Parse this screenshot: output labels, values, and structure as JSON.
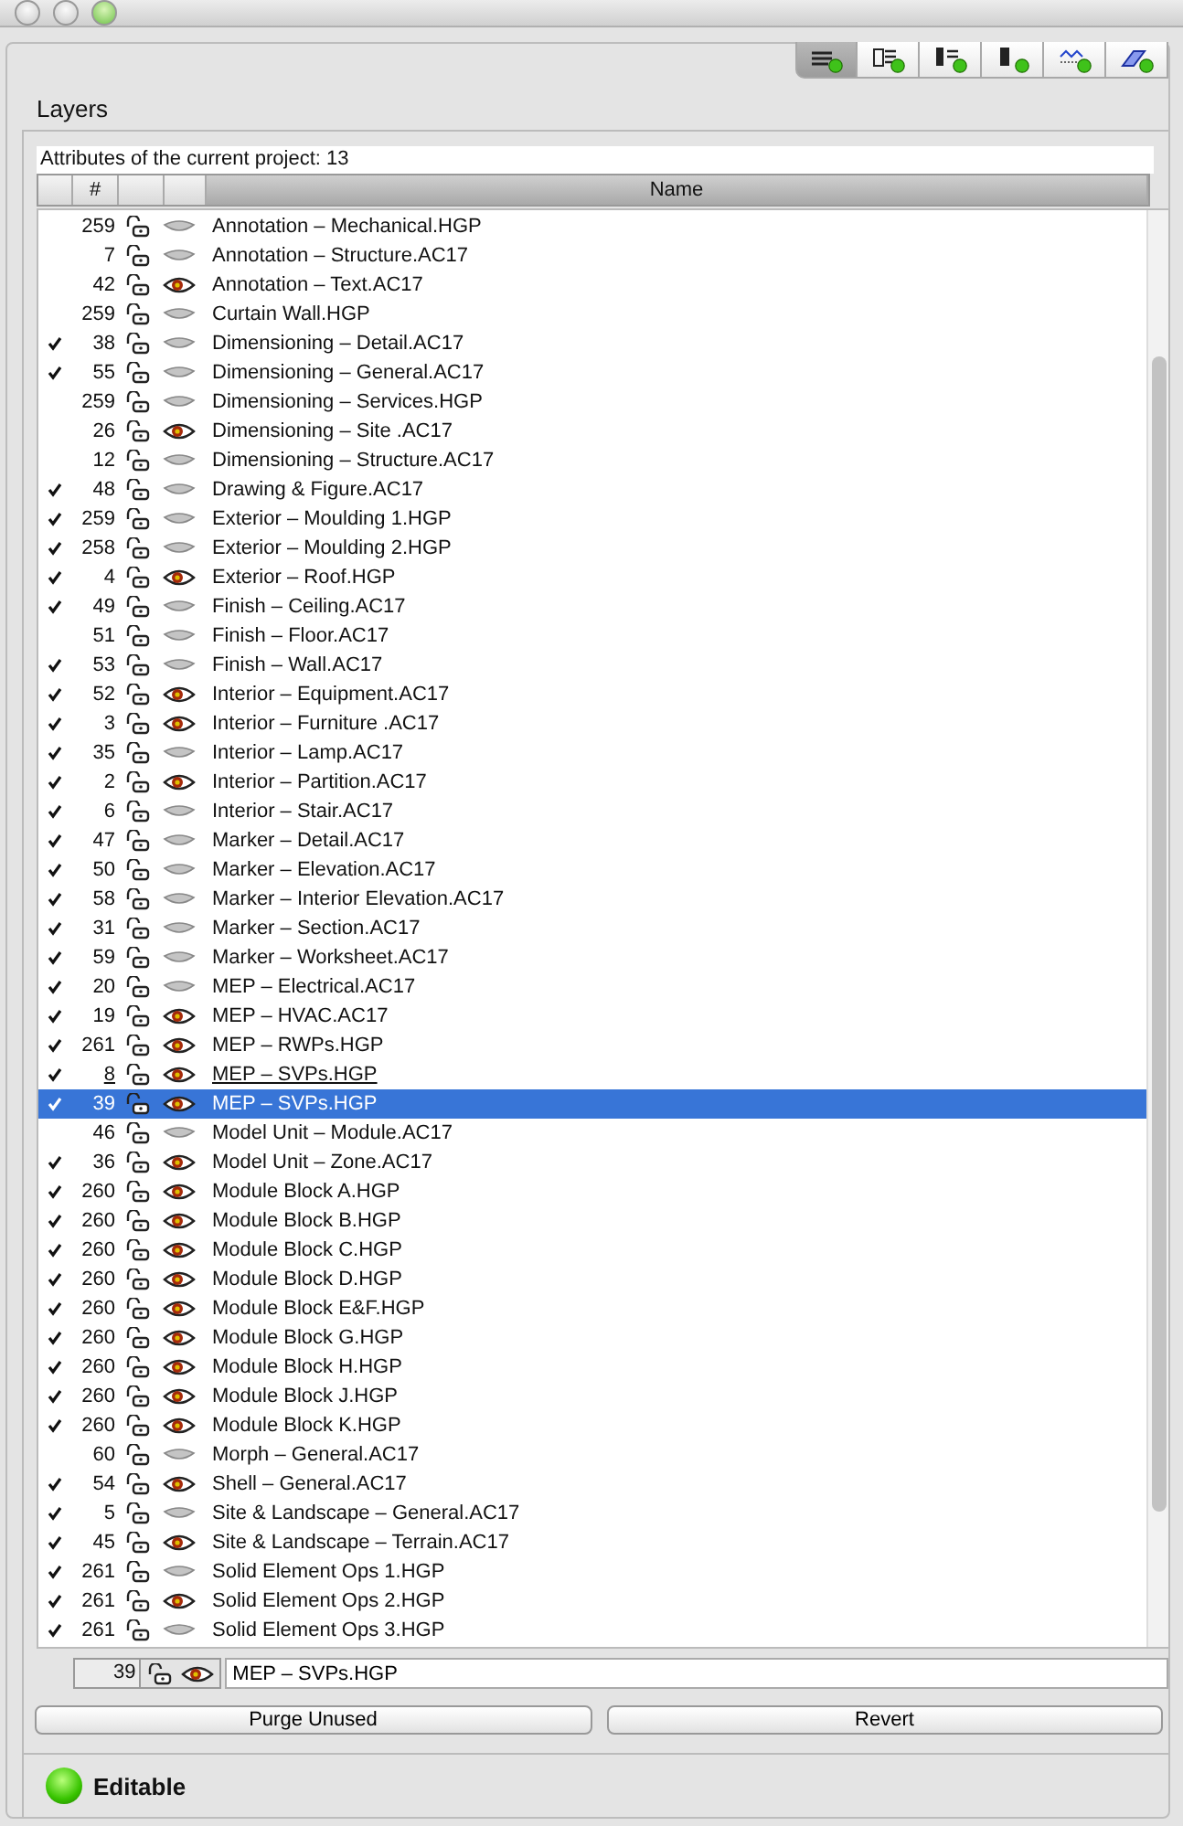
{
  "toolbar": [
    {
      "selected": true
    },
    {
      "selected": false
    },
    {
      "selected": false
    },
    {
      "selected": false
    },
    {
      "selected": false
    },
    {
      "selected": false
    }
  ],
  "panel_title": "Layers",
  "attributes_caption": "Attributes of the current project: 13",
  "table": {
    "columns": [
      "#",
      "Name"
    ],
    "rows": [
      {
        "checked": false,
        "number": "259",
        "visible": false,
        "name": "Annotation – Mechanical.HGP",
        "underlined": false,
        "selected": false
      },
      {
        "checked": false,
        "number": "7",
        "visible": false,
        "name": "Annotation – Structure.AC17",
        "underlined": false,
        "selected": false
      },
      {
        "checked": false,
        "number": "42",
        "visible": true,
        "name": "Annotation – Text.AC17",
        "underlined": false,
        "selected": false
      },
      {
        "checked": false,
        "number": "259",
        "visible": false,
        "name": "Curtain Wall.HGP",
        "underlined": false,
        "selected": false
      },
      {
        "checked": true,
        "number": "38",
        "visible": false,
        "name": "Dimensioning – Detail.AC17",
        "underlined": false,
        "selected": false
      },
      {
        "checked": true,
        "number": "55",
        "visible": false,
        "name": "Dimensioning – General.AC17",
        "underlined": false,
        "selected": false
      },
      {
        "checked": false,
        "number": "259",
        "visible": false,
        "name": "Dimensioning – Services.HGP",
        "underlined": false,
        "selected": false
      },
      {
        "checked": false,
        "number": "26",
        "visible": true,
        "name": "Dimensioning – Site .AC17",
        "underlined": false,
        "selected": false
      },
      {
        "checked": false,
        "number": "12",
        "visible": false,
        "name": "Dimensioning – Structure.AC17",
        "underlined": false,
        "selected": false
      },
      {
        "checked": true,
        "number": "48",
        "visible": false,
        "name": "Drawing & Figure.AC17",
        "underlined": false,
        "selected": false
      },
      {
        "checked": true,
        "number": "259",
        "visible": false,
        "name": "Exterior – Moulding 1.HGP",
        "underlined": false,
        "selected": false
      },
      {
        "checked": true,
        "number": "258",
        "visible": false,
        "name": "Exterior – Moulding 2.HGP",
        "underlined": false,
        "selected": false
      },
      {
        "checked": true,
        "number": "4",
        "visible": true,
        "name": "Exterior – Roof.HGP",
        "underlined": false,
        "selected": false
      },
      {
        "checked": true,
        "number": "49",
        "visible": false,
        "name": "Finish – Ceiling.AC17",
        "underlined": false,
        "selected": false
      },
      {
        "checked": false,
        "number": "51",
        "visible": false,
        "name": "Finish – Floor.AC17",
        "underlined": false,
        "selected": false
      },
      {
        "checked": true,
        "number": "53",
        "visible": false,
        "name": "Finish – Wall.AC17",
        "underlined": false,
        "selected": false
      },
      {
        "checked": true,
        "number": "52",
        "visible": true,
        "name": "Interior – Equipment.AC17",
        "underlined": false,
        "selected": false
      },
      {
        "checked": true,
        "number": "3",
        "visible": true,
        "name": "Interior – Furniture .AC17",
        "underlined": false,
        "selected": false
      },
      {
        "checked": true,
        "number": "35",
        "visible": false,
        "name": "Interior – Lamp.AC17",
        "underlined": false,
        "selected": false
      },
      {
        "checked": true,
        "number": "2",
        "visible": true,
        "name": "Interior – Partition.AC17",
        "underlined": false,
        "selected": false
      },
      {
        "checked": true,
        "number": "6",
        "visible": false,
        "name": "Interior – Stair.AC17",
        "underlined": false,
        "selected": false
      },
      {
        "checked": true,
        "number": "47",
        "visible": false,
        "name": "Marker – Detail.AC17",
        "underlined": false,
        "selected": false
      },
      {
        "checked": true,
        "number": "50",
        "visible": false,
        "name": "Marker – Elevation.AC17",
        "underlined": false,
        "selected": false
      },
      {
        "checked": true,
        "number": "58",
        "visible": false,
        "name": "Marker – Interior Elevation.AC17",
        "underlined": false,
        "selected": false
      },
      {
        "checked": true,
        "number": "31",
        "visible": false,
        "name": "Marker – Section.AC17",
        "underlined": false,
        "selected": false
      },
      {
        "checked": true,
        "number": "59",
        "visible": false,
        "name": "Marker – Worksheet.AC17",
        "underlined": false,
        "selected": false
      },
      {
        "checked": true,
        "number": "20",
        "visible": false,
        "name": "MEP – Electrical.AC17",
        "underlined": false,
        "selected": false
      },
      {
        "checked": true,
        "number": "19",
        "visible": true,
        "name": "MEP – HVAC.AC17",
        "underlined": false,
        "selected": false
      },
      {
        "checked": true,
        "number": "261",
        "visible": true,
        "name": "MEP – RWPs.HGP",
        "underlined": false,
        "selected": false
      },
      {
        "checked": true,
        "number": "8",
        "visible": true,
        "name": "MEP – SVPs.HGP",
        "underlined": true,
        "selected": false
      },
      {
        "checked": true,
        "number": "39",
        "visible": true,
        "name": "MEP – SVPs.HGP",
        "underlined": false,
        "selected": true
      },
      {
        "checked": false,
        "number": "46",
        "visible": false,
        "name": "Model Unit – Module.AC17",
        "underlined": false,
        "selected": false
      },
      {
        "checked": true,
        "number": "36",
        "visible": true,
        "name": "Model Unit – Zone.AC17",
        "underlined": false,
        "selected": false
      },
      {
        "checked": true,
        "number": "260",
        "visible": true,
        "name": "Module Block A.HGP",
        "underlined": false,
        "selected": false
      },
      {
        "checked": true,
        "number": "260",
        "visible": true,
        "name": "Module Block B.HGP",
        "underlined": false,
        "selected": false
      },
      {
        "checked": true,
        "number": "260",
        "visible": true,
        "name": "Module Block C.HGP",
        "underlined": false,
        "selected": false
      },
      {
        "checked": true,
        "number": "260",
        "visible": true,
        "name": "Module Block D.HGP",
        "underlined": false,
        "selected": false
      },
      {
        "checked": true,
        "number": "260",
        "visible": true,
        "name": "Module Block E&F.HGP",
        "underlined": false,
        "selected": false
      },
      {
        "checked": true,
        "number": "260",
        "visible": true,
        "name": "Module Block G.HGP",
        "underlined": false,
        "selected": false
      },
      {
        "checked": true,
        "number": "260",
        "visible": true,
        "name": "Module Block H.HGP",
        "underlined": false,
        "selected": false
      },
      {
        "checked": true,
        "number": "260",
        "visible": true,
        "name": "Module Block J.HGP",
        "underlined": false,
        "selected": false
      },
      {
        "checked": true,
        "number": "260",
        "visible": true,
        "name": "Module Block K.HGP",
        "underlined": false,
        "selected": false
      },
      {
        "checked": false,
        "number": "60",
        "visible": false,
        "name": "Morph – General.AC17",
        "underlined": false,
        "selected": false
      },
      {
        "checked": true,
        "number": "54",
        "visible": true,
        "name": "Shell – General.AC17",
        "underlined": false,
        "selected": false
      },
      {
        "checked": true,
        "number": "5",
        "visible": false,
        "name": "Site & Landscape – General.AC17",
        "underlined": false,
        "selected": false
      },
      {
        "checked": true,
        "number": "45",
        "visible": true,
        "name": "Site & Landscape – Terrain.AC17",
        "underlined": false,
        "selected": false
      },
      {
        "checked": true,
        "number": "261",
        "visible": false,
        "name": "Solid Element Ops 1.HGP",
        "underlined": false,
        "selected": false
      },
      {
        "checked": true,
        "number": "261",
        "visible": true,
        "name": "Solid Element Ops 2.HGP",
        "underlined": false,
        "selected": false
      },
      {
        "checked": true,
        "number": "261",
        "visible": false,
        "name": "Solid Element Ops 3.HGP",
        "underlined": false,
        "selected": false
      }
    ]
  },
  "editor": {
    "number": "39",
    "visible": true,
    "name": "MEP – SVPs.HGP"
  },
  "buttons": [
    "Purge Unused",
    "Revert"
  ],
  "status": {
    "label": "Editable",
    "on": true
  }
}
